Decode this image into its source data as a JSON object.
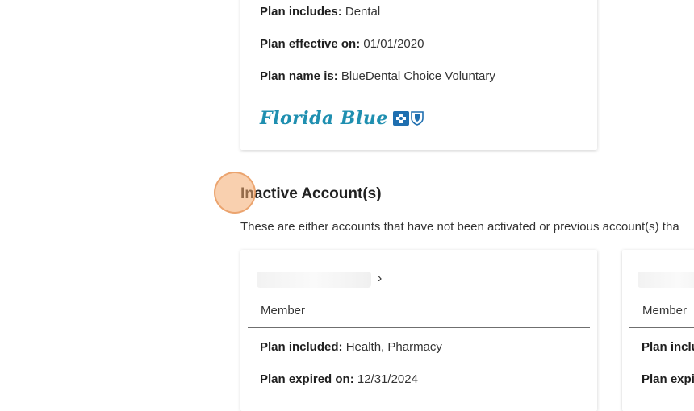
{
  "active_plan": {
    "includes_label": "Plan includes:",
    "includes_value": "Dental",
    "effective_label": "Plan effective on:",
    "effective_value": "01/01/2020",
    "name_label": "Plan name is:",
    "name_value": "BlueDental Choice Voluntary",
    "logo_text": "Florida Blue"
  },
  "inactive_section": {
    "title": "Inactive Account(s)",
    "description": "These are either accounts that have not been activated or previous account(s) tha"
  },
  "inactive_cards": [
    {
      "chevron": "›",
      "member_label": "Member",
      "included_label": "Plan included:",
      "included_value": "Health, Pharmacy",
      "expired_label": "Plan expired on:",
      "expired_value": "12/31/2024"
    },
    {
      "member_label": "Member",
      "included_label_partial": "Plan inclu",
      "expired_label_partial": "Plan expi"
    }
  ],
  "colors": {
    "logo": "#1f8fb0",
    "cross": "#1f6fb0",
    "highlight": "#f4aa6e"
  }
}
